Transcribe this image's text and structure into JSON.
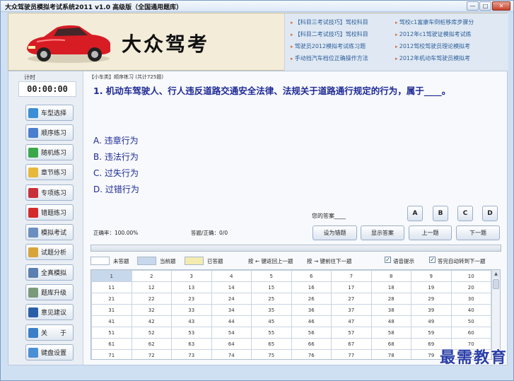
{
  "window": {
    "title": "大众驾驶员模拟考试系统2011  v1.0  高级版（全国通用题库）"
  },
  "banner": {
    "brand": "大众驾考",
    "links": [
      "【科目三考试技巧】驾校科目",
      "驾校c1富康车倒桩移库步骤分",
      "【科目二考试技巧】驾校科目",
      "2012年c1驾驶证模拟考试练",
      "驾驶员2012模拟考试练习题",
      "2012驾校驾驶员理论模拟考",
      "手动挡汽车档位正确操作方法",
      "2012年机动车驾驶员模拟考"
    ]
  },
  "timer": {
    "label": "计时",
    "value": "00:00:00"
  },
  "nav": [
    {
      "label": "车型选择",
      "icon": "car-type-icon",
      "color": "#3a8fd6"
    },
    {
      "label": "顺序练习",
      "icon": "sequence-icon",
      "color": "#4a7fcf"
    },
    {
      "label": "随机练习",
      "icon": "random-icon",
      "color": "#3aa84a"
    },
    {
      "label": "章节练习",
      "icon": "folder-icon",
      "color": "#e8b83a"
    },
    {
      "label": "专项练习",
      "icon": "checklist-icon",
      "color": "#c9303a"
    },
    {
      "label": "错题练习",
      "icon": "flag-icon",
      "color": "#d42a2a"
    },
    {
      "label": "模拟考试",
      "icon": "exam-icon",
      "color": "#6b8fbf"
    },
    {
      "label": "试题分析",
      "icon": "analysis-icon",
      "color": "#d8a43a"
    },
    {
      "label": "全真模拟",
      "icon": "simulation-icon",
      "color": "#5a7fb0"
    },
    {
      "label": "题库升级",
      "icon": "upgrade-icon",
      "color": "#7a9a7a"
    },
    {
      "label": "意见建议",
      "icon": "help-icon",
      "color": "#2a5fa8"
    },
    {
      "label": "关　　于",
      "icon": "info-icon",
      "color": "#3a7fc8"
    },
    {
      "label": "键盘设置",
      "icon": "keyboard-icon",
      "color": "#4a8fd8"
    }
  ],
  "question": {
    "header": "【小车类】顺序练习 (共计725题)",
    "text": "1. 机动车驾驶人、行人违反道路交通安全法律、法规关于道路通行规定的行为，属于____。",
    "options": [
      "A. 违章行为",
      "B. 违法行为",
      "C. 过失行为",
      "D. 过错行为"
    ]
  },
  "answer": {
    "label": "您的答案____",
    "choices": [
      "A",
      "B",
      "C",
      "D"
    ]
  },
  "stats": {
    "accuracy": "正确率：100.00%",
    "answered": "答题/正确：0/0"
  },
  "actions": {
    "mark_wrong": "设为错题",
    "show_answer": "显示答案",
    "prev": "上一题",
    "next": "下一题"
  },
  "legend": {
    "unanswered": "未答题",
    "current": "当前题",
    "answered": "已答题",
    "hint_prev": "按 ← 键返回上一题",
    "hint_next": "按 → 键前往下一题",
    "voice": "语音提示",
    "auto_next": "答完自动转到下一题",
    "colors": {
      "unanswered": "#ffffff",
      "current": "#c8d8ec",
      "answered": "#f3ecb0"
    }
  },
  "grid": {
    "rows": [
      [
        "1",
        "2",
        "3",
        "4",
        "5",
        "6",
        "7",
        "8",
        "9",
        "10"
      ],
      [
        "11",
        "12",
        "13",
        "14",
        "15",
        "16",
        "17",
        "18",
        "19",
        "20"
      ],
      [
        "21",
        "22",
        "23",
        "24",
        "25",
        "26",
        "27",
        "28",
        "29",
        "30"
      ],
      [
        "31",
        "32",
        "33",
        "34",
        "35",
        "36",
        "37",
        "38",
        "39",
        "40"
      ],
      [
        "41",
        "42",
        "43",
        "44",
        "45",
        "46",
        "47",
        "48",
        "49",
        "50"
      ],
      [
        "51",
        "52",
        "53",
        "54",
        "55",
        "56",
        "57",
        "58",
        "59",
        "60"
      ],
      [
        "61",
        "62",
        "63",
        "64",
        "65",
        "66",
        "67",
        "68",
        "69",
        "70"
      ],
      [
        "71",
        "72",
        "73",
        "74",
        "75",
        "76",
        "77",
        "78",
        "79",
        "80"
      ]
    ]
  },
  "watermark": "最需教育"
}
